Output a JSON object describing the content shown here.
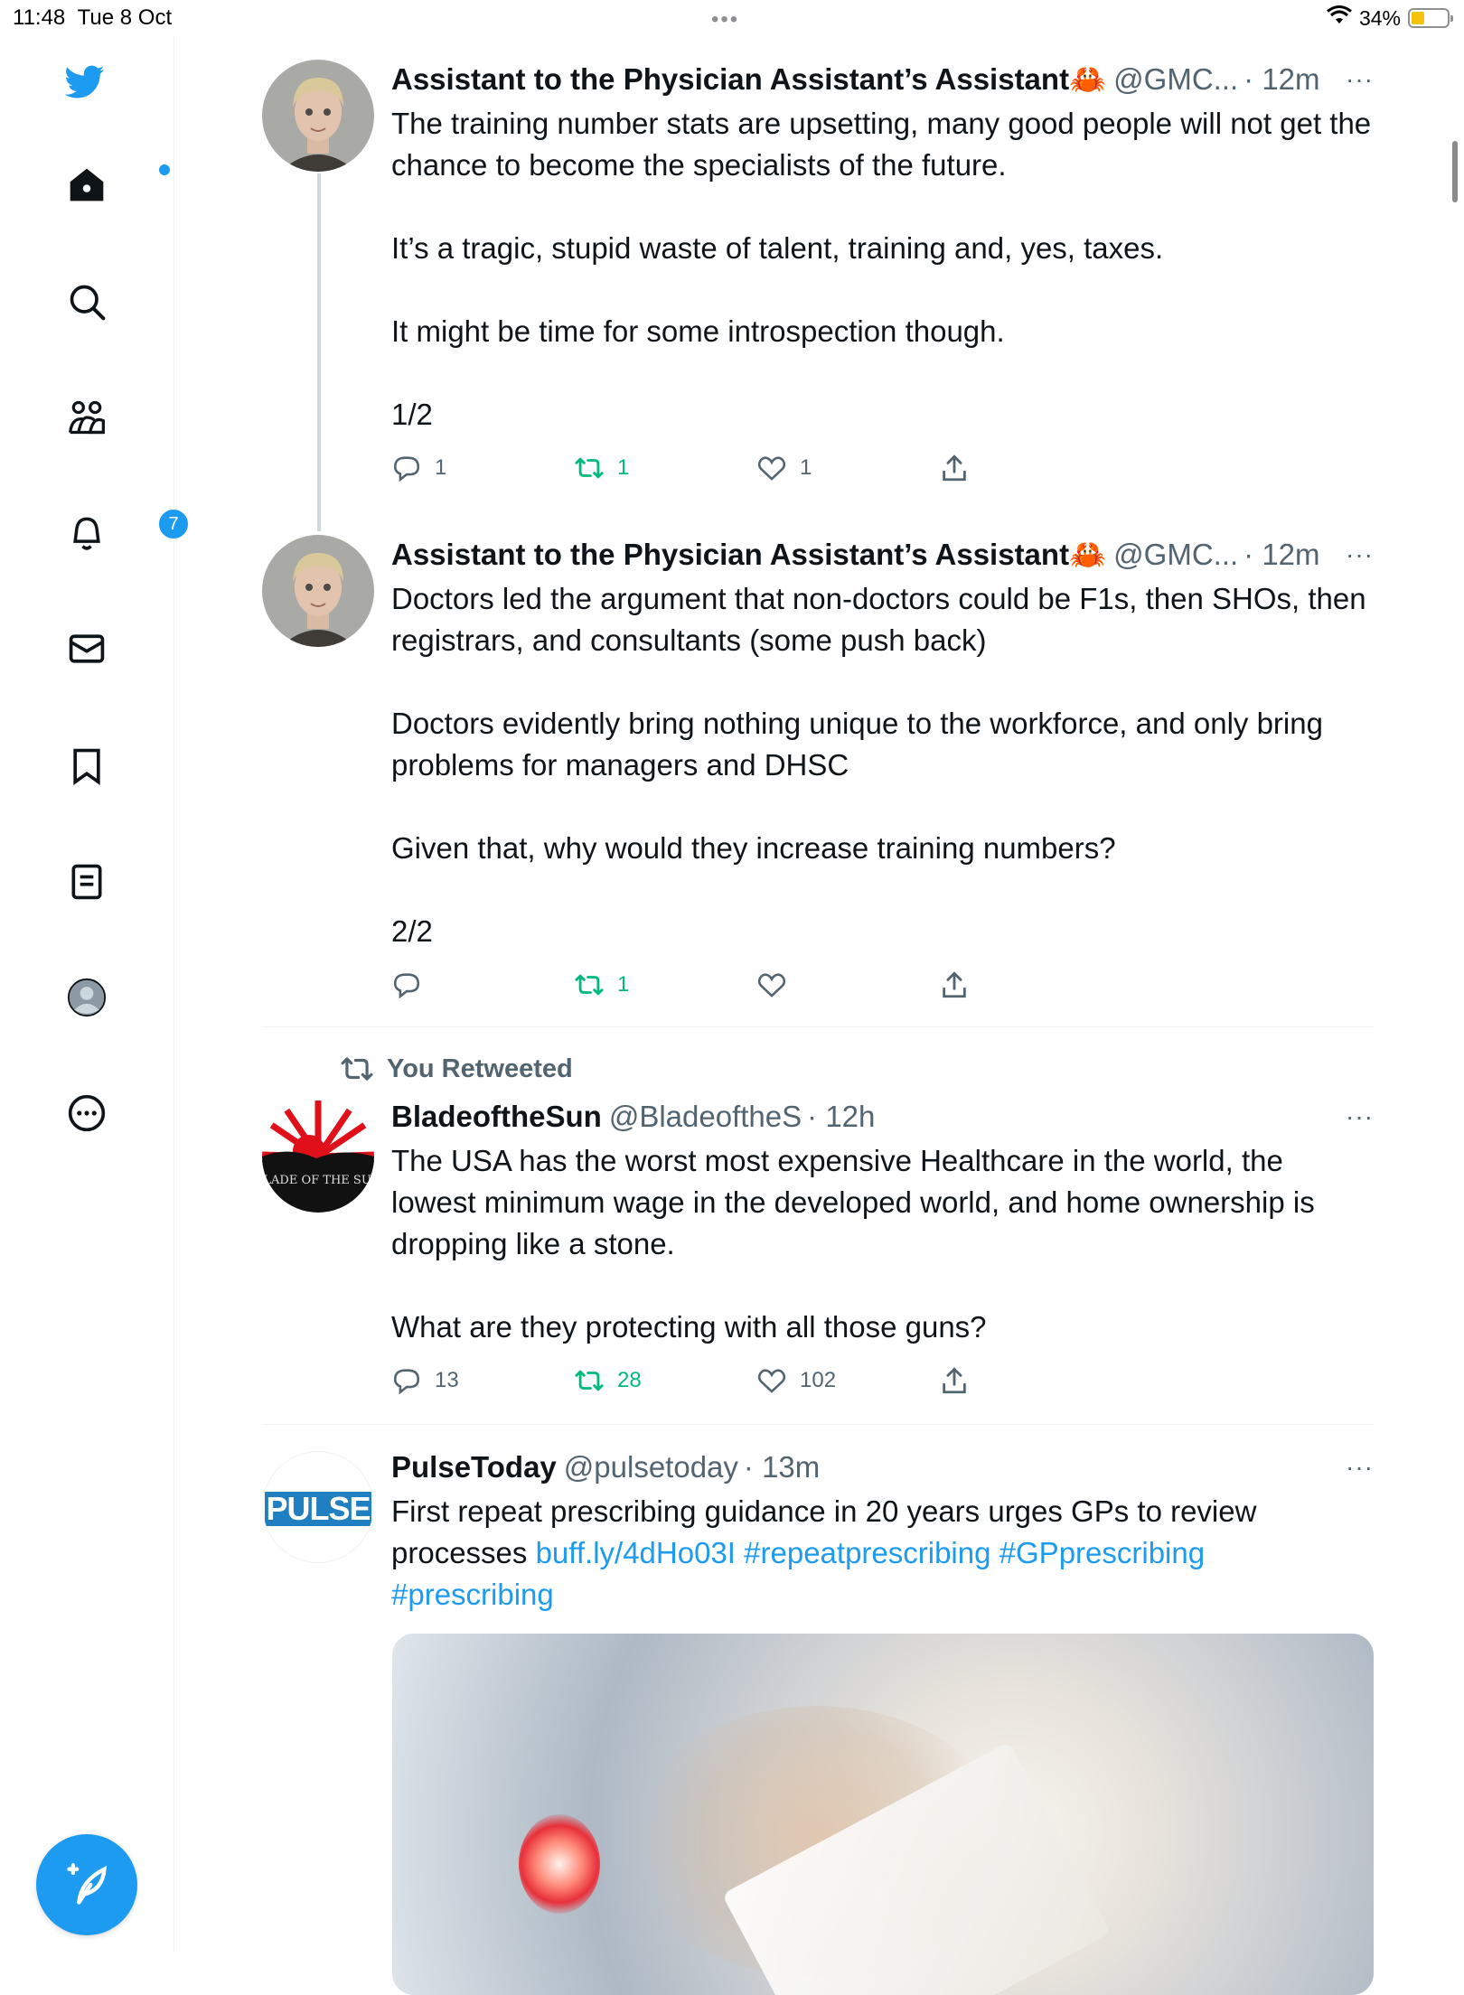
{
  "status_bar": {
    "time": "11:48",
    "date": "Tue 8 Oct",
    "battery": "34%",
    "battery_level": 0.34,
    "dots": "•••"
  },
  "sidebar": {
    "items": [
      {
        "name": "home",
        "icon": "home-icon",
        "has_dot": true
      },
      {
        "name": "explore",
        "icon": "search-icon"
      },
      {
        "name": "communities",
        "icon": "communities-icon"
      },
      {
        "name": "notifications",
        "icon": "bell-icon",
        "badge": "7"
      },
      {
        "name": "messages",
        "icon": "mail-icon"
      },
      {
        "name": "bookmarks",
        "icon": "bookmark-icon"
      },
      {
        "name": "lists",
        "icon": "list-icon"
      },
      {
        "name": "profile",
        "icon": "profile-icon"
      },
      {
        "name": "more",
        "icon": "more-circle-icon"
      }
    ],
    "compose_icon": "compose-icon"
  },
  "colors": {
    "accent": "#1d9bf0",
    "retweet": "#00ba7c",
    "muted": "#536471",
    "text": "#0f1419"
  },
  "tweets": [
    {
      "name": "Assistant to the Physician Assistant’s Assistant",
      "emoji": "🦀",
      "handle": "@GMC...",
      "time": "· 12m",
      "more": "···",
      "text": "The training number stats are upsetting, many good people will not get the chance to become the specialists of the future.\n\nIt’s a tragic, stupid waste of talent, training and, yes, taxes.\n\nIt might be time for some introspection though.\n\n1/2",
      "replies": "1",
      "retweets": "1",
      "likes": "1"
    },
    {
      "name": "Assistant to the Physician Assistant’s Assistant",
      "emoji": "🦀",
      "handle": "@GMC...",
      "time": "· 12m",
      "more": "···",
      "text": "Doctors led the argument that non-doctors could be F1s, then SHOs, then registrars, and consultants (some push back)\n\nDoctors evidently bring nothing unique to the workforce, and only bring problems for managers and DHSC\n\nGiven that, why would they increase training numbers?\n\n2/2",
      "replies": "",
      "retweets": "1",
      "likes": ""
    },
    {
      "retweet_label": "You Retweeted",
      "name": "BladeoftheSun",
      "handle": "@BladeoftheS",
      "time": "· 12h",
      "more": "···",
      "avatar_text": "BLADE OF THE SUN",
      "text": "The USA has the worst most expensive Healthcare in the world, the lowest minimum wage in the developed world, and home ownership is dropping like a stone.\n\nWhat are they protecting with all those guns?",
      "replies": "13",
      "retweets": "28",
      "likes": "102"
    },
    {
      "name": "PulseToday",
      "handle": "@pulsetoday",
      "time": "· 13m",
      "more": "···",
      "avatar_text": "PULSE",
      "text_plain": "First repeat prescribing guidance in 20 years urges GPs to review processes ",
      "links": [
        "buff.ly/4dHo03I",
        "#repeatprescribing",
        "#GPprescribing",
        "#prescribing"
      ]
    }
  ]
}
